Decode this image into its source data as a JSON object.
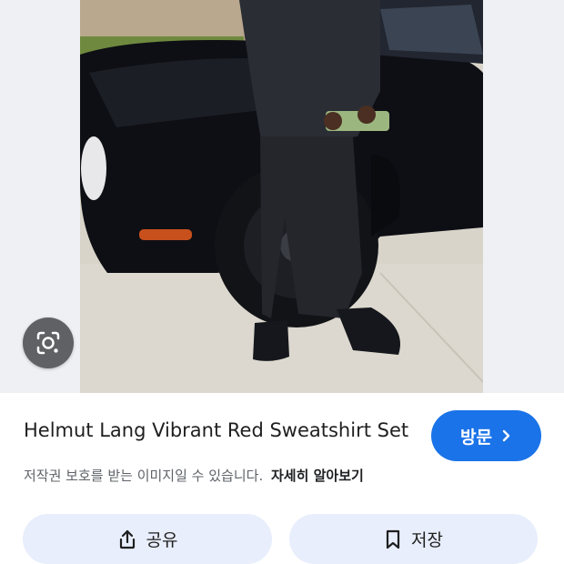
{
  "result": {
    "title": "Helmut Lang Vibrant Red Sweatshirt Set",
    "visit_label": "방문",
    "copyright_notice": "저작권 보호를 받는 이미지일 수 있습니다.",
    "learn_more": "자세히 알아보기"
  },
  "actions": {
    "share_label": "공유",
    "save_label": "저장"
  },
  "icons": {
    "lens": "lens-search-icon",
    "visit": "chevron-right-icon",
    "share": "share-icon",
    "save": "bookmark-icon"
  },
  "colors": {
    "accent": "#1a73e8",
    "pill_background": "#e8eefb",
    "lens_button": "#5f6164"
  }
}
